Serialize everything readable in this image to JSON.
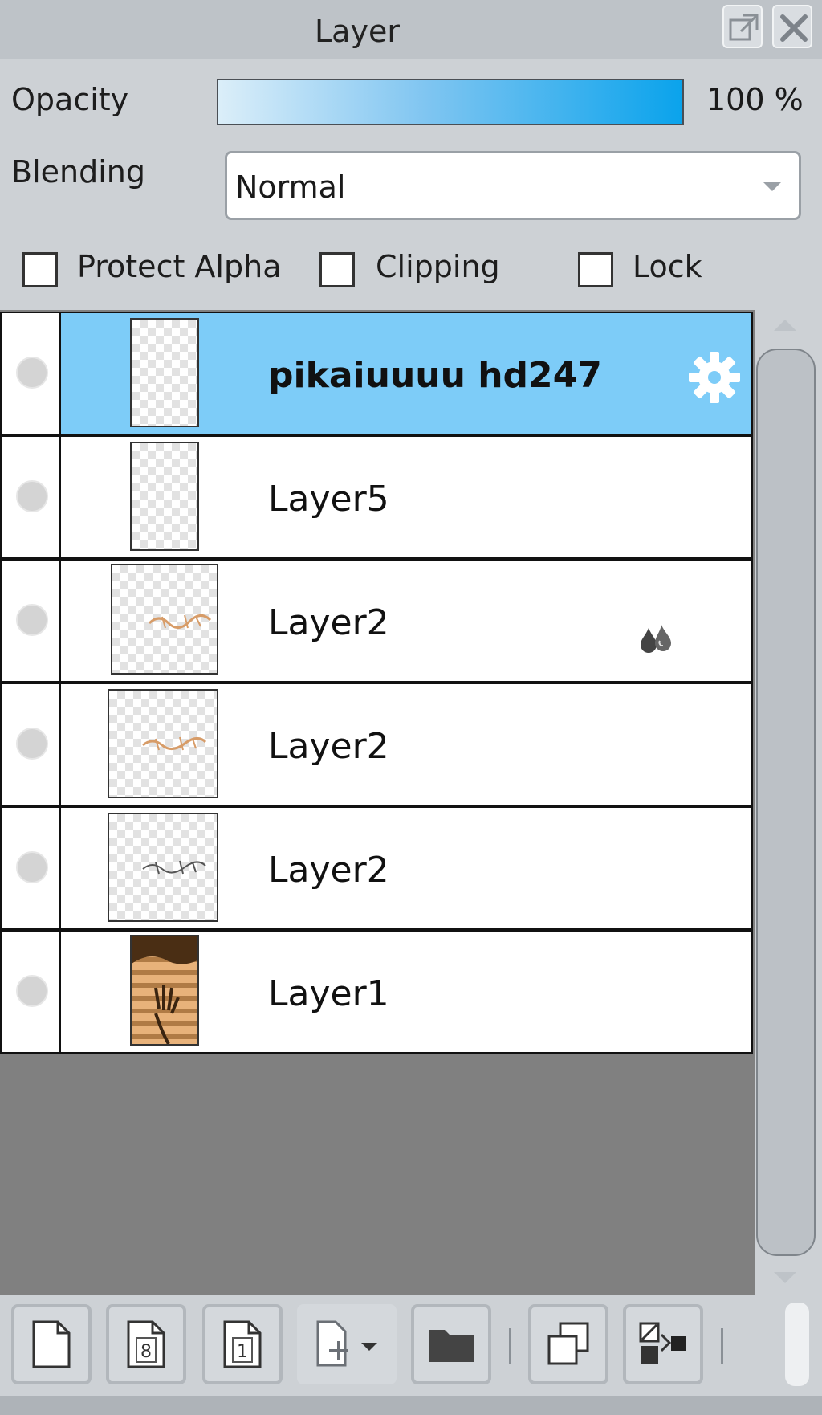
{
  "panel": {
    "title": "Layer"
  },
  "controls": {
    "opacity_label": "Opacity",
    "opacity_value": "100 %",
    "opacity_fraction": 1.0,
    "blending_label": "Blending",
    "blending_value": "Normal",
    "protect_alpha_label": "Protect Alpha",
    "clipping_label": "Clipping",
    "lock_label": "Lock"
  },
  "layers": [
    {
      "name": "pikaiuuuu hd247",
      "selected": true,
      "icon": "gear-icon"
    },
    {
      "name": "Layer5",
      "selected": false
    },
    {
      "name": "Layer2",
      "selected": false,
      "icon": "droplets-icon"
    },
    {
      "name": "Layer2",
      "selected": false
    },
    {
      "name": "Layer2",
      "selected": false
    },
    {
      "name": "Layer1",
      "selected": false
    }
  ],
  "colors": {
    "selected_row": "#7dccf8",
    "opacity_bar_end": "#0aa3ec",
    "list_bg": "#808080"
  },
  "footer": {
    "icons": [
      "new-layer-icon",
      "new-8bit-layer-icon",
      "new-1bit-layer-icon",
      "add-layer-dropdown-icon",
      "folder-icon",
      "duplicate-layer-icon",
      "merge-down-icon"
    ]
  }
}
